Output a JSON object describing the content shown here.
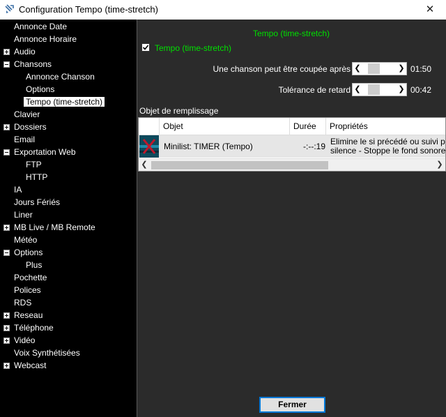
{
  "window": {
    "title": "Configuration Tempo (time-stretch)",
    "close_glyph": "✕"
  },
  "tree": {
    "items": [
      {
        "label": "Annonce Date",
        "expander": ""
      },
      {
        "label": "Annonce Horaire",
        "expander": ""
      },
      {
        "label": "Audio",
        "expander": "plus"
      },
      {
        "label": "Chansons",
        "expander": "minus"
      },
      {
        "label": "Annonce Chanson",
        "expander": ""
      },
      {
        "label": "Options",
        "expander": ""
      },
      {
        "label": "Tempo (time-stretch)",
        "expander": "",
        "selected": true
      },
      {
        "label": "Clavier",
        "expander": ""
      },
      {
        "label": "Dossiers",
        "expander": "plus"
      },
      {
        "label": "Email",
        "expander": ""
      },
      {
        "label": "Exportation Web",
        "expander": "minus"
      },
      {
        "label": "FTP",
        "expander": ""
      },
      {
        "label": "HTTP",
        "expander": ""
      },
      {
        "label": "IA",
        "expander": ""
      },
      {
        "label": "Jours Fériés",
        "expander": ""
      },
      {
        "label": "Liner",
        "expander": ""
      },
      {
        "label": "MB Live / MB Remote",
        "expander": "plus"
      },
      {
        "label": "Météo",
        "expander": ""
      },
      {
        "label": "Options",
        "expander": "minus"
      },
      {
        "label": "Plus",
        "expander": ""
      },
      {
        "label": "Pochette",
        "expander": ""
      },
      {
        "label": "Polices",
        "expander": ""
      },
      {
        "label": "RDS",
        "expander": ""
      },
      {
        "label": "Reseau",
        "expander": "plus"
      },
      {
        "label": "Téléphone",
        "expander": "plus"
      },
      {
        "label": "Vidéo",
        "expander": "plus"
      },
      {
        "label": "Voix Synthétisées",
        "expander": ""
      },
      {
        "label": "Webcast",
        "expander": "plus"
      }
    ]
  },
  "content": {
    "section_title": "Tempo (time-stretch)",
    "enable_checkbox": {
      "label": "Tempo (time-stretch)",
      "checked": true
    },
    "cut_after": {
      "label": "Une chanson peut être coupée après",
      "value": "01:50"
    },
    "tolerance": {
      "label": "Tolérance de retard",
      "value": "00:42"
    },
    "filler_label": "Objet de remplissage",
    "grid": {
      "headers": {
        "object": "Objet",
        "duration": "Durée",
        "properties": "Propriétés"
      },
      "rows": [
        {
          "object": "Minilist: TIMER (Tempo)",
          "duration": "-:--:19",
          "properties_line1": "Elimine le si précédé ou suivi par u",
          "properties_line2": "silence - Stoppe le fond sonore"
        }
      ]
    }
  },
  "footer": {
    "close_button": "Fermer"
  },
  "colors": {
    "accent_green": "#00e000",
    "selection_bg": "#ffffff",
    "focus_border": "#0078d7"
  }
}
